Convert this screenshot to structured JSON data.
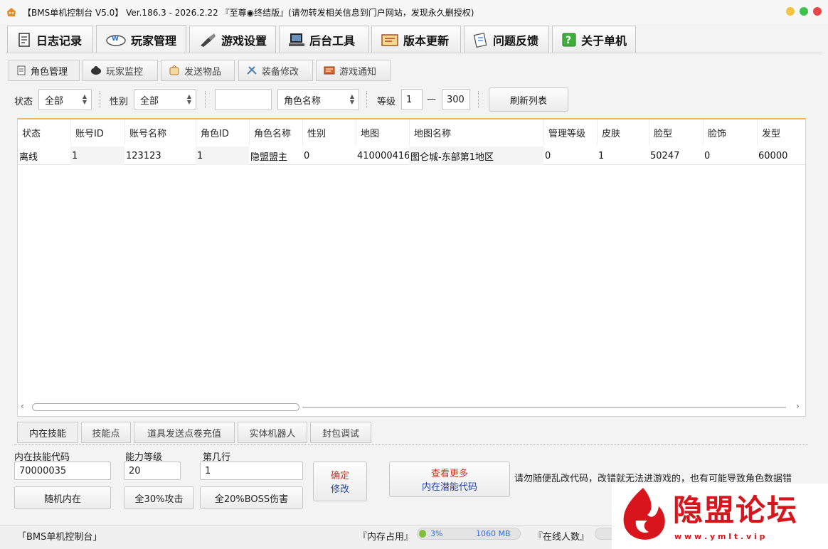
{
  "window": {
    "title": "【BMS单机控制台 V5.0】 Ver.186.3 - 2026.2.22 『至尊◉终结版』(请勿转发相关信息到门户网站，发现永久删授权)",
    "controls": {
      "minimize_color": "#f5c242",
      "maximize_color": "#3cc24a",
      "close_color": "#e8464a"
    }
  },
  "main_tabs": [
    {
      "label": "日志记录",
      "icon": "log-book-icon"
    },
    {
      "label": "玩家管理",
      "icon": "player-manage-icon",
      "active": true
    },
    {
      "label": "游戏设置",
      "icon": "game-settings-icon"
    },
    {
      "label": "后台工具",
      "icon": "computer-icon"
    },
    {
      "label": "版本更新",
      "icon": "update-icon"
    },
    {
      "label": "问题反馈",
      "icon": "feedback-icon"
    },
    {
      "label": "关于单机",
      "icon": "help-icon"
    }
  ],
  "sub_tabs": [
    {
      "label": "角色管理",
      "icon": "role-icon",
      "active": true
    },
    {
      "label": "玩家监控",
      "icon": "monitor-icon"
    },
    {
      "label": "发送物品",
      "icon": "item-icon"
    },
    {
      "label": "装备修改",
      "icon": "equip-icon"
    },
    {
      "label": "游戏通知",
      "icon": "notify-icon"
    }
  ],
  "filters": {
    "status_label": "状态",
    "status_value": "全部",
    "gender_label": "性别",
    "gender_value": "全部",
    "search_value": "",
    "search_field": "角色名称",
    "level_label": "等级",
    "level_min": "1",
    "level_dash": "—",
    "level_max": "300",
    "refresh_label": "刷新列表"
  },
  "table": {
    "columns": [
      "状态",
      "账号ID",
      "账号名称",
      "角色ID",
      "角色名称",
      "性别",
      "地图",
      "地图名称",
      "管理等级",
      "皮肤",
      "脸型",
      "脸饰",
      "发型"
    ],
    "rows": [
      [
        "离线",
        "1",
        "123123",
        "1",
        "隐盟盟主",
        "0",
        "410000416",
        "图仑城-东部第1地区",
        "0",
        "1",
        "50247",
        "0",
        "60000"
      ]
    ]
  },
  "bottom_tabs": [
    {
      "label": "内在技能",
      "active": true
    },
    {
      "label": "技能点"
    },
    {
      "label": "道具发送点卷充值"
    },
    {
      "label": "实体机器人"
    },
    {
      "label": "封包调试"
    }
  ],
  "inner_skill": {
    "code_label": "内在技能代码",
    "code_value": "70000035",
    "level_label": "能力等级",
    "level_value": "20",
    "row_label": "第几行",
    "row_value": "1",
    "confirm_line1": "确定",
    "confirm_line2": "修改",
    "more_line1": "查看更多",
    "more_line2": "内在潜能代码",
    "random_label": "随机内在",
    "attack_label": "全30%攻击",
    "boss_label": "全20%BOSS伤害",
    "warning": "请勿随便乱改代码，改错就无法进游戏的，也有可能导致角色数据错"
  },
  "statusbar": {
    "app_name": "「BMS单机控制台」",
    "memory_label": "『内存占用』",
    "memory_percent": "3%",
    "memory_size": "1060 MB",
    "memory_fraction": 0.03,
    "online_label": "『在线人数』"
  },
  "watermark": {
    "title": "隐盟论坛",
    "url": "w w w . y m l t . v i p"
  }
}
